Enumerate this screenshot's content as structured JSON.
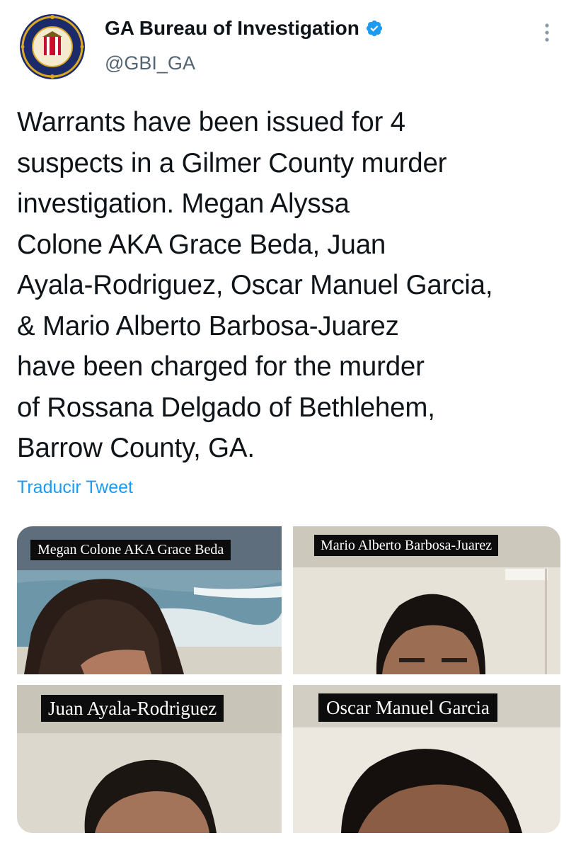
{
  "account": {
    "display_name": "GA Bureau of Investigation",
    "handle": "@GBI_GA",
    "avatar_icon": "gbi-seal-icon",
    "verified_icon": "verified-badge-icon",
    "accent_color": "#1d9bf0"
  },
  "tweet": {
    "text": "Warrants have been issued for 4\nsuspects in a Gilmer County murder\ninvestigation.  Megan Alyssa\nColone AKA Grace Beda, Juan\nAyala-Rodriguez, Oscar Manuel Garcia,\n& Mario Alberto Barbosa-Juarez\nhave been charged for the murder\nof Rossana Delgado of Bethlehem,\nBarrow County, GA.",
    "translate_label": "Traducir Tweet"
  },
  "media": {
    "photos": [
      {
        "label": "Megan Colone AKA Grace Beda"
      },
      {
        "label": "Mario Alberto Barbosa-Juarez"
      },
      {
        "label": "Juan Ayala-Rodriguez"
      },
      {
        "label": "Oscar Manuel Garcia"
      }
    ]
  }
}
